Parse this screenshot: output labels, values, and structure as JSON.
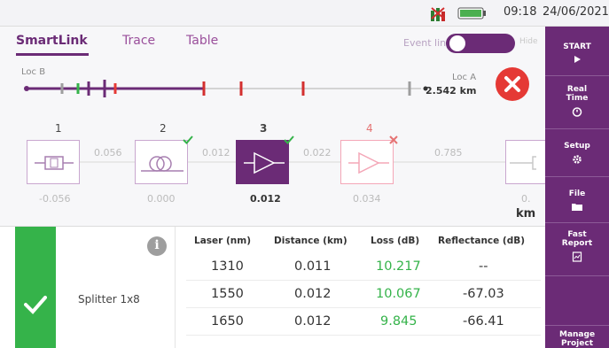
{
  "status": {
    "time": "09:18",
    "date": "24/06/2021"
  },
  "tabs": [
    {
      "label": "SmartLink",
      "active": true
    },
    {
      "label": "Trace",
      "active": false
    },
    {
      "label": "Table",
      "active": false
    }
  ],
  "event_line": {
    "label": "Event line",
    "state": "Hide"
  },
  "link": {
    "loc_b": "Loc B",
    "loc_a": "Loc A",
    "length": "2.542 km"
  },
  "events": [
    {
      "index": "1",
      "position": "-0.056",
      "status": "none",
      "icon": "connector-icon"
    },
    {
      "index": "2",
      "position": "0.000",
      "status": "pass",
      "icon": "fiber-reel-icon"
    },
    {
      "index": "3",
      "position": "0.012",
      "status": "pass",
      "icon": "splitter-icon"
    },
    {
      "index": "4",
      "position": "0.034",
      "status": "fail",
      "icon": "splitter-icon"
    },
    {
      "index": "",
      "position": "0.",
      "status": "none",
      "icon": "end-connector-icon"
    }
  ],
  "segments": [
    "0.056",
    "0.012",
    "0.022",
    "0.785"
  ],
  "unit": "km",
  "selected_event": {
    "type": "Splitter 1x8",
    "result": "pass"
  },
  "table": {
    "headers": [
      "Laser (nm)",
      "Distance (km)",
      "Loss  (dB)",
      "Reflectance (dB)"
    ],
    "rows": [
      [
        "1310",
        "0.011",
        "10.217",
        "--"
      ],
      [
        "1550",
        "0.012",
        "10.067",
        "-67.03"
      ],
      [
        "1650",
        "0.012",
        "9.845",
        "-66.41"
      ]
    ]
  },
  "sidebar": [
    {
      "label": "START",
      "icon": "play-icon"
    },
    {
      "label": "Real Time",
      "icon": "timer-icon"
    },
    {
      "label": "Setup",
      "icon": "gear-icon"
    },
    {
      "label": "File",
      "icon": "folder-icon"
    },
    {
      "label": "Fast Report",
      "icon": "report-icon"
    },
    {
      "label": "",
      "icon": ""
    },
    {
      "label": "Manage Project",
      "icon": ""
    }
  ],
  "colors": {
    "accent": "#6b2b76",
    "pass": "#35b34a",
    "fail": "#e53935"
  }
}
